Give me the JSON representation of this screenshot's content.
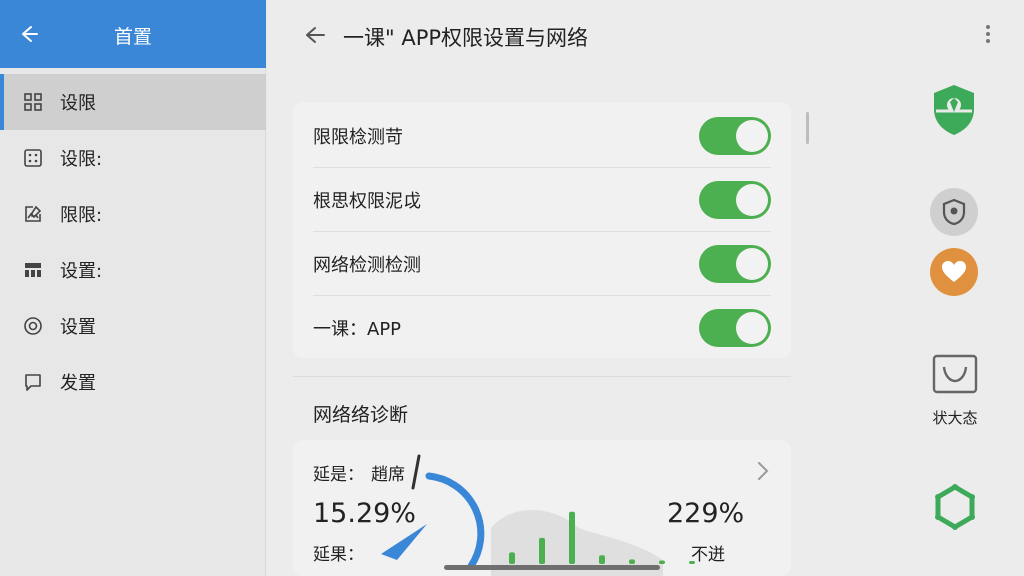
{
  "sidebar": {
    "title": "首置",
    "items": [
      {
        "label": "设限",
        "icon": "grid-icon",
        "active": true
      },
      {
        "label": "设限:",
        "icon": "dice-icon"
      },
      {
        "label": "限限:",
        "icon": "edit-image-icon"
      },
      {
        "label": "设置:",
        "icon": "table-icon"
      },
      {
        "label": "设置",
        "icon": "target-icon"
      },
      {
        "label": "发置",
        "icon": "chat-icon"
      }
    ]
  },
  "header": {
    "title": "一课\" APP权限设置与网络"
  },
  "toggles": [
    {
      "label": "限限棯测苛",
      "on": true
    },
    {
      "label": "根思权限泥戉",
      "on": true
    },
    {
      "label": "网络检测检测",
      "on": true
    },
    {
      "label": "一课：APP",
      "on": true
    }
  ],
  "diagnostics": {
    "section_title": "网络络诊断",
    "latency_label": "延是：",
    "latency_value": "趙席",
    "left_percent": "15.29%",
    "result_label": "延果：",
    "right_percent": "229%",
    "right_caption": "不迸",
    "gauge_level": 0.29,
    "bars": [
      0.2,
      0.45,
      0.9,
      0.15,
      0.08,
      0.06,
      0.05
    ]
  },
  "rail": {
    "status_label": "状大态"
  },
  "colors": {
    "accent_blue": "#3a87d8",
    "toggle_green": "#4caf50",
    "shield_green": "#3daa5a",
    "heart_orange": "#e0913f"
  }
}
